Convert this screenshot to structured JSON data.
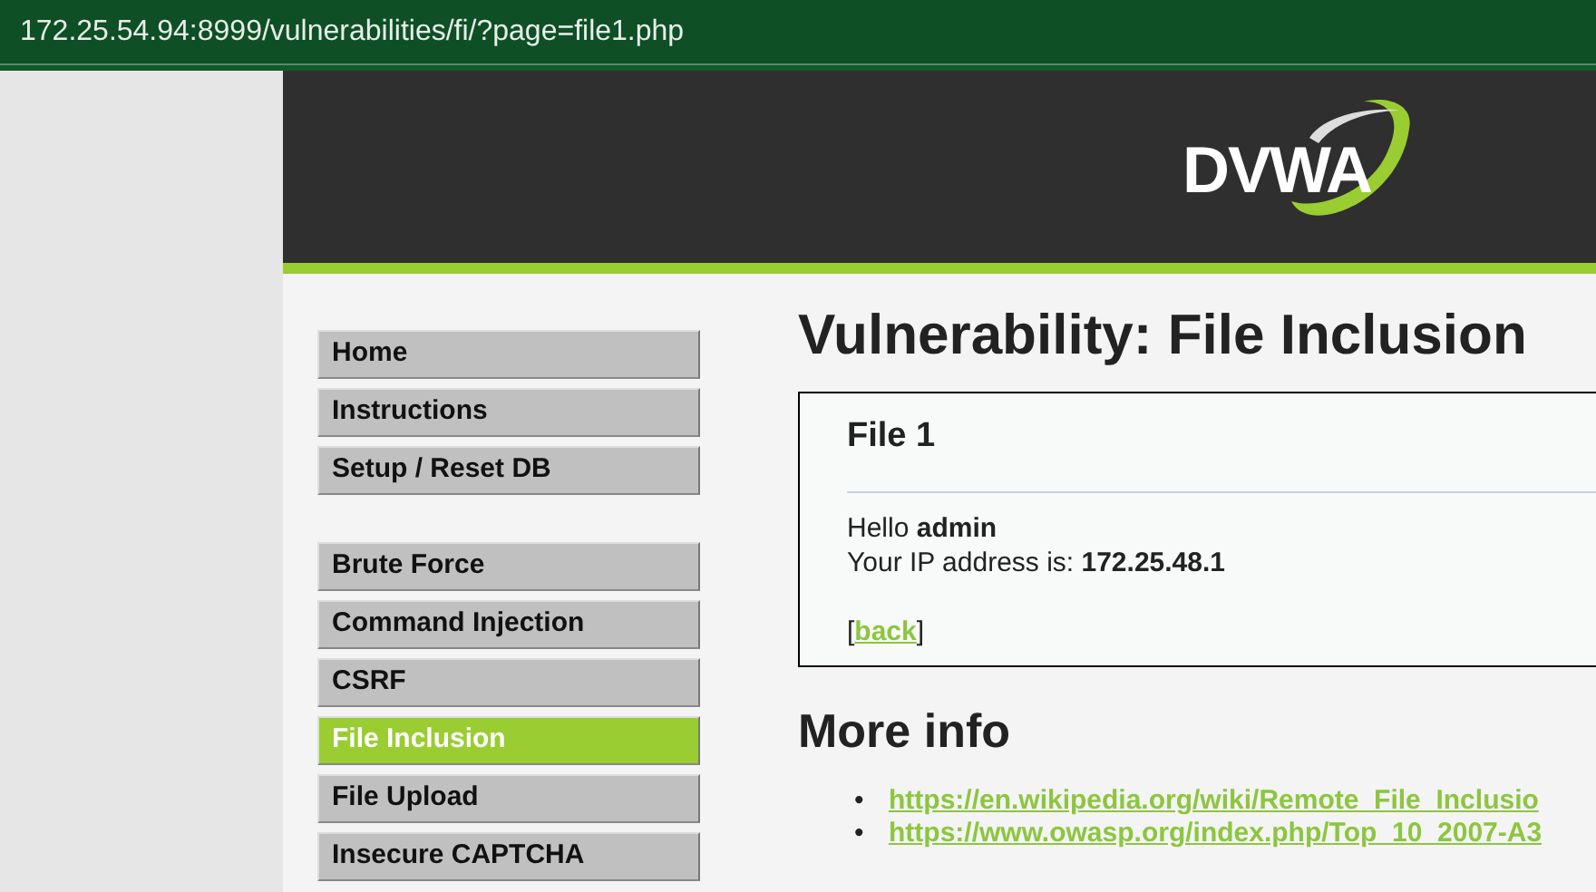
{
  "address_bar": {
    "url": "172.25.54.94:8999/vulnerabilities/fi/?page=file1.php"
  },
  "header": {
    "logo": "DVWA"
  },
  "menu_groups": [
    {
      "items": [
        {
          "label": "Home",
          "selected": false
        },
        {
          "label": "Instructions",
          "selected": false
        },
        {
          "label": "Setup / Reset DB",
          "selected": false
        }
      ]
    },
    {
      "items": [
        {
          "label": "Brute Force",
          "selected": false
        },
        {
          "label": "Command Injection",
          "selected": false
        },
        {
          "label": "CSRF",
          "selected": false
        },
        {
          "label": "File Inclusion",
          "selected": true
        },
        {
          "label": "File Upload",
          "selected": false
        },
        {
          "label": "Insecure CAPTCHA",
          "selected": false
        }
      ]
    }
  ],
  "content": {
    "title": "Vulnerability: File Inclusion",
    "panel": {
      "heading": "File 1",
      "lines": [
        "Hello **admin**",
        "Your IP address is: **172.25.48.1**"
      ],
      "back": {
        "open": "[",
        "link": "back",
        "close": "]"
      }
    },
    "more_info": {
      "heading": "More info",
      "links": [
        {
          "bullet": "•",
          "url": "https://en.wikipedia.org/wiki/Remote_File_Inclusio"
        },
        {
          "bullet": "•",
          "url": "https://www.owasp.org/index.php/Top_10_2007-A3"
        }
      ]
    }
  }
}
